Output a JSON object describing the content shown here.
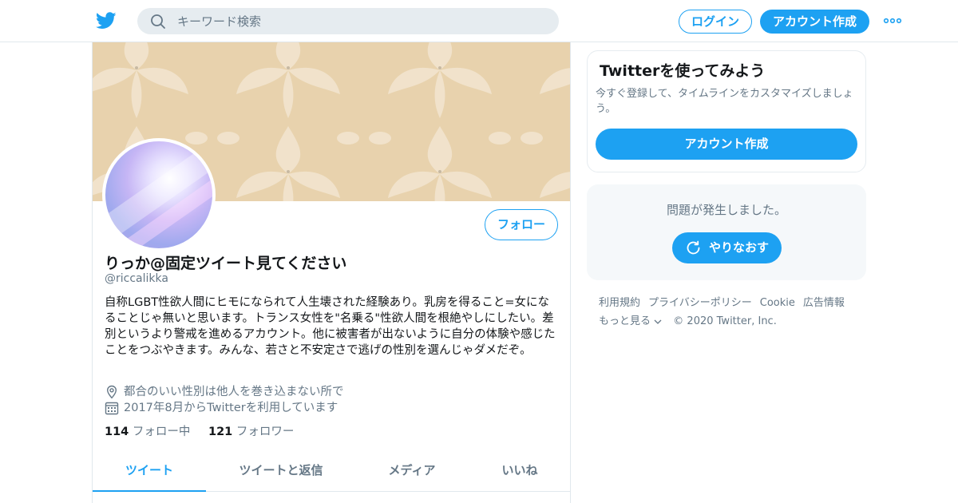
{
  "header": {
    "search_placeholder": "キーワード検索",
    "login_label": "ログイン",
    "signup_label": "アカウント作成",
    "brand_color": "#1da1f2"
  },
  "profile": {
    "follow_label": "フォロー",
    "display_name": "りっか@固定ツイート見てください",
    "handle": "@riccalikka",
    "bio": "自称LGBT性欲人間にヒモになられて人生壊された経験あり。乳房を得ること=女になることじゃ無いと思います。トランス女性を\"名乗る\"性欲人間を根絶やしにしたい。差別というより警戒を進めるアカウント。他に被害者が出ないように自分の体験や感じたことをつぶやきます。みんな、若さと不安定さで逃げの性別を選んじゃダメだぞ。",
    "location": "都合のいい性別は他人を巻き込まない所で",
    "joined": "2017年8月からTwitterを利用しています",
    "following_count": "114",
    "following_label": "フォロー中",
    "followers_count": "121",
    "followers_label": "フォロワー"
  },
  "tabs": [
    {
      "label": "ツイート",
      "active": true
    },
    {
      "label": "ツイートと返信",
      "active": false
    },
    {
      "label": "メディア",
      "active": false
    },
    {
      "label": "いいね",
      "active": false
    }
  ],
  "sidebar": {
    "signup_card": {
      "title": "Twitterを使ってみよう",
      "text": "今すぐ登録して、タイムラインをカスタマイズしましょう。",
      "button": "アカウント作成"
    },
    "error_card": {
      "message": "問題が発生しました。",
      "retry_button": "やりなおす"
    },
    "footer": {
      "links": [
        "利用規約",
        "プライバシーポリシー",
        "Cookie",
        "広告情報"
      ],
      "more": "もっと見る",
      "copyright": "© 2020 Twitter, Inc."
    }
  }
}
